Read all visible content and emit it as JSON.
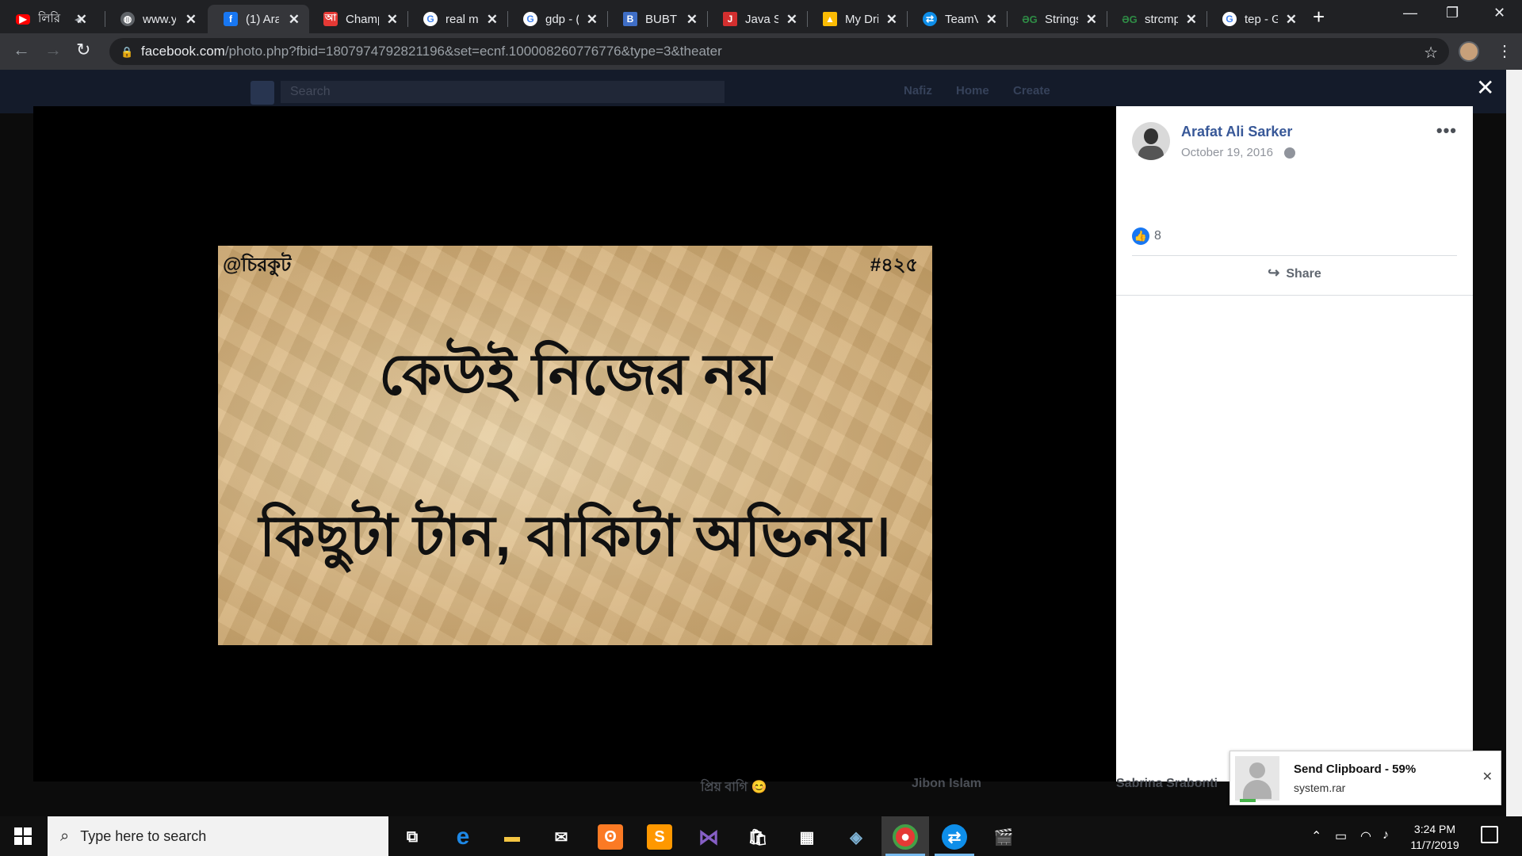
{
  "browser": {
    "tabs": [
      {
        "title": "লিরি",
        "icon": "youtube-icon",
        "color": "#ff0000"
      },
      {
        "title": "www.y",
        "icon": "globe-icon",
        "color": "#9aa0a6"
      },
      {
        "title": "(1) Ara",
        "icon": "facebook-icon",
        "color": "#1877f2",
        "active": true
      },
      {
        "title": "Champ",
        "icon": "champ-icon",
        "color": "#e53935"
      },
      {
        "title": "real m",
        "icon": "google-icon",
        "color": "#4285f4"
      },
      {
        "title": "gdp - (",
        "icon": "google-icon",
        "color": "#4285f4"
      },
      {
        "title": "BUBT /",
        "icon": "bubt-icon",
        "color": "#3f6ec6"
      },
      {
        "title": "Java St",
        "icon": "java-icon",
        "color": "#d32f2f"
      },
      {
        "title": "My Dri",
        "icon": "drive-icon",
        "color": "#fbbc04"
      },
      {
        "title": "TeamV",
        "icon": "teamviewer-icon",
        "color": "#0e8ee9"
      },
      {
        "title": "Strings",
        "icon": "gfg-icon",
        "color": "#2f8d46"
      },
      {
        "title": "strcmp",
        "icon": "gfg-icon",
        "color": "#2f8d46"
      },
      {
        "title": "tep - G",
        "icon": "google-icon",
        "color": "#4285f4"
      }
    ],
    "url_host": "facebook.com",
    "url_path": "/photo.php?fbid=1807974792821196&set=ecnf.100008260776776&type=3&theater"
  },
  "fb_nav": {
    "search_placeholder": "Search",
    "user": "Nafiz",
    "home": "Home",
    "create": "Create"
  },
  "photo": {
    "corner_left": "@চিরকুট",
    "corner_right": "#৪২৫",
    "line1": "কেউই নিজের নয়",
    "line2": "কিছুটা টান, বাকিটা অভিনয়।"
  },
  "post": {
    "author": "Arafat Ali Sarker",
    "date": "October 19, 2016",
    "likes": "8",
    "share_label": "Share"
  },
  "chat": {
    "c1": "প্রিয় বাগি 😊",
    "c2": "Jibon Islam",
    "c3": "Sabrina Srabonti"
  },
  "notification": {
    "title": "Send Clipboard - 59%",
    "file": "system.rar",
    "progress": 0.59
  },
  "taskbar": {
    "search_placeholder": "Type here to search",
    "time": "3:24 PM",
    "date": "11/7/2019"
  },
  "colors": {
    "fb_blue": "#385898",
    "like_blue": "#1877f2",
    "accent": "#76b9ed"
  }
}
